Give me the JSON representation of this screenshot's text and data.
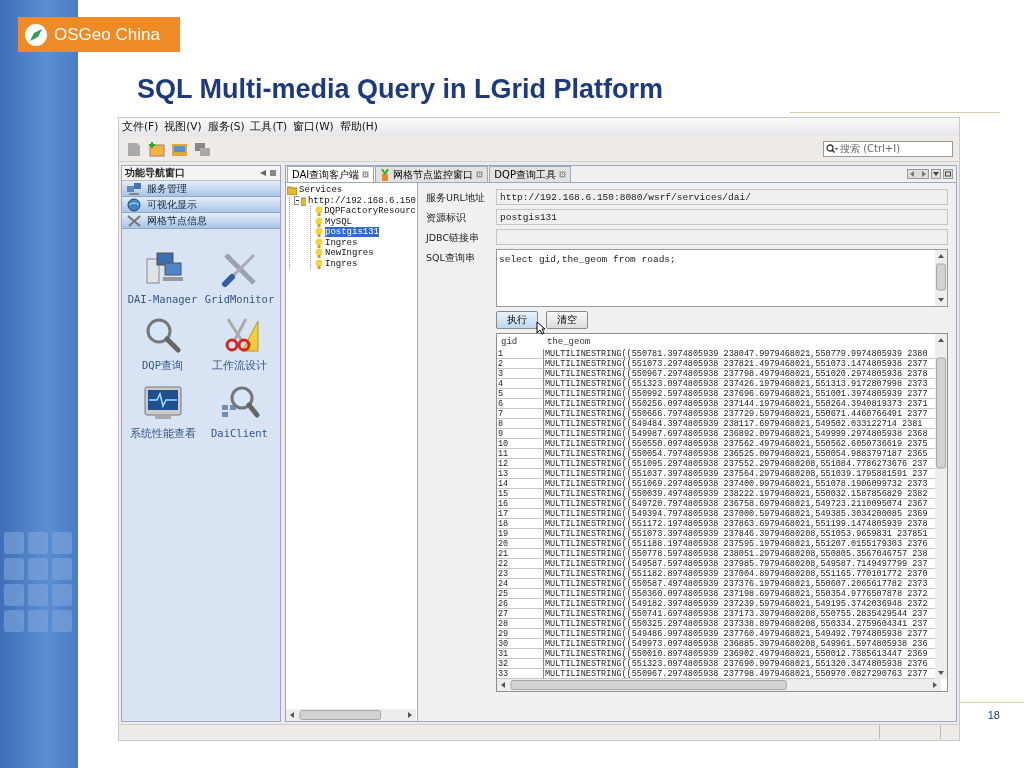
{
  "logo": "OSGeo China",
  "title": "SQL Multi-media Query in LGrid Platform",
  "app": {
    "menu": [
      "文件(F)",
      "视图(V)",
      "服务(S)",
      "工具(T)",
      "窗口(W)",
      "帮助(H)"
    ],
    "search": {
      "placeholder": "搜索 (Ctrl+I)"
    },
    "nav": {
      "title": "功能导航窗口",
      "sections": [
        "服务管理",
        "可视化显示",
        "网格节点信息"
      ],
      "tools": [
        "DAI-Manager",
        "GridMonitor",
        "DQP查询",
        "工作流设计",
        "系统性能查看",
        "DaiClient"
      ]
    },
    "tabs": [
      {
        "label": "DAI查询客户端",
        "selected": true
      },
      {
        "label": "网格节点监控窗口",
        "selected": false
      },
      {
        "label": "DQP查询工具",
        "selected": false
      }
    ],
    "tree": {
      "label": "Services",
      "selected": false,
      "children": [
        {
          "label": "http://192.168.6.150",
          "selected": false,
          "expanded": true,
          "children": [
            {
              "label": "DQPFactoryResourc",
              "selected": false
            },
            {
              "label": "MySQL",
              "selected": false
            },
            {
              "label": "postgis131",
              "selected": true
            },
            {
              "label": "Ingres",
              "selected": false
            },
            {
              "label": "NewIngres",
              "selected": false
            },
            {
              "label": "Ingres",
              "selected": false
            }
          ]
        }
      ]
    },
    "form": {
      "fields": [
        {
          "kind": "text",
          "label": "服务URL地址",
          "value": "http://192.168.6.150:8080/wsrf/services/dai/"
        },
        {
          "kind": "text",
          "label": "资源标识",
          "value": "postgis131"
        },
        {
          "kind": "text",
          "label": "JDBC链接串"
        },
        {
          "kind": "textarea",
          "label": "SQL查询串",
          "value": "select gid,the_geom from roads;"
        }
      ],
      "buttons": [
        "执行",
        "清空"
      ]
    },
    "table": {
      "columns": [
        "gid",
        "the_geom"
      ],
      "rows": [
        [
          "1",
          "MULTILINESTRING((550781.3974805939 238047.9979468021,550779.9974805939 2380"
        ],
        [
          "2",
          "MULTILINESTRING((551073.2974805938 237821.4979468021,551073.1474805938 2377"
        ],
        [
          "3",
          "MULTILINESTRING((550967.2974805938 237798.4979468021,551020.2974805938 2378"
        ],
        [
          "4",
          "MULTILINESTRING((551323.0974805938 237426.1979468021,551313.9172807998 2373"
        ],
        [
          "5",
          "MULTILINESTRING((550992.5974805938 237696.6979468021,551001.3974805939 2377"
        ],
        [
          "6",
          "MULTILINESTRING((550256.0974805938 237144.1979468021,550264.3940819373 2371"
        ],
        [
          "7",
          "MULTILINESTRING((550666.7974805938 237729.5979468021,550671.4460766491 2377"
        ],
        [
          "8",
          "MULTILINESTRING((549484.3974805939 238117.6979468021,549502.033122714 2381"
        ],
        [
          "9",
          "MULTILINESTRING((549987.6974805938 236892.0979468021,549999.2974805938 2368"
        ],
        [
          "10",
          "MULTILINESTRING((550550.0974805938 237562.4979468021,550562.6050736619 2375"
        ],
        [
          "11",
          "MULTILINESTRING((550054.7974805938 236525.0979468021,550054.9883797187 2365"
        ],
        [
          "12",
          "MULTILINESTRING((551095.2974805938 237552.29794680208,551084.7786273676 237"
        ],
        [
          "13",
          "MULTILINESTRING((551037.3974805939 237564.29794680208,551039.1795881591 237"
        ],
        [
          "14",
          "MULTILINESTRING((551069.2974805938 237400.9979468021,551078.1906099732 2373"
        ],
        [
          "15",
          "MULTILINESTRING((550039.4974805939 238222.1979468021,550032.1587856829 2382"
        ],
        [
          "16",
          "MULTILINESTRING((549720.7974805938 236758.6979468021,549723.2110095074 2367"
        ],
        [
          "17",
          "MULTILINESTRING((549394.7974805938 237000.5979468021,549385.3034200085 2369"
        ],
        [
          "18",
          "MULTILINESTRING((551172.1974805938 237863.6979468021,551199.1474805939 2378"
        ],
        [
          "19",
          "MULTILINESTRING((551073.3974805939 237846.39794680208,551053.9659831 237851"
        ],
        [
          "20",
          "MULTILINESTRING((551188.1974805938 237595.1979468021,551207.0155179303 2376"
        ],
        [
          "21",
          "MULTILINESTRING((550778.5974805938 238051.29794680208,550805.3567046757 238"
        ],
        [
          "22",
          "MULTILINESTRING((549587.5974805938 237985.79794680208,549587.7149497799 237"
        ],
        [
          "23",
          "MULTILINESTRING((551182.8974805939 237004.89794680208,551165.770101772 2370"
        ],
        [
          "24",
          "MULTILINESTRING((550587.4974805939 237376.1979468021,550607.2065617782 2373"
        ],
        [
          "25",
          "MULTILINESTRING((550360.0974805938 237198.6979468021,550354.9776507878 2372"
        ],
        [
          "26",
          "MULTILINESTRING((549182.3974805939 237239.5979468021,549195.3742036948 2372"
        ],
        [
          "27",
          "MULTILINESTRING((550741.6974805938 237173.39794680208,550755.2835429544 237"
        ],
        [
          "28",
          "MULTILINESTRING((550325.2974805938 237338.89794680208,550334.2759604341 237"
        ],
        [
          "29",
          "MULTILINESTRING((549486.9974805939 237760.4979468021,549492.7974805938 2377"
        ],
        [
          "30",
          "MULTILINESTRING((549973.0974805938 236885.39794680208,549961.5974805938 236"
        ],
        [
          "31",
          "MULTILINESTRING((550010.8974805939 236902.4979468021,550012.7385613447 2369"
        ],
        [
          "32",
          "MULTILINESTRING((551323.0974805938 237690.9979468021,551320.3474805938 2376"
        ],
        [
          "33",
          "MULTILINESTRING((550967.2974805938 237798.4979468021,550970.0827290763 2377"
        ]
      ]
    }
  },
  "page_number": "18"
}
